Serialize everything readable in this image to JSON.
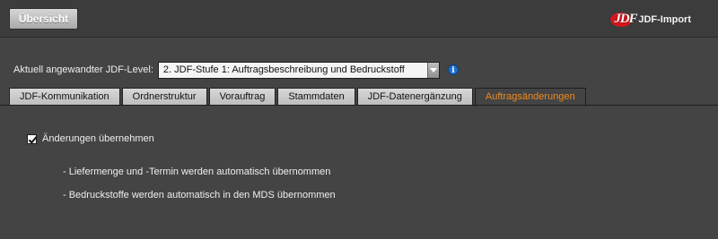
{
  "header": {
    "overview_button": "Übersicht",
    "brand_logo_text": "JDF",
    "brand_title": "JDF-Import"
  },
  "level": {
    "label": "Aktuell angewandter JDF-Level:",
    "selected": "2. JDF-Stufe 1: Auftragsbeschreibung und Bedruckstoff",
    "info_icon": "info-icon"
  },
  "tabs": [
    {
      "label": "JDF-Kommunikation",
      "active": false
    },
    {
      "label": "Ordnerstruktur",
      "active": false
    },
    {
      "label": "Vorauftrag",
      "active": false
    },
    {
      "label": "Stammdaten",
      "active": false
    },
    {
      "label": "JDF-Datenergänzung",
      "active": false
    },
    {
      "label": "Auftragsänderungen",
      "active": true
    }
  ],
  "content": {
    "checkbox_label": "Änderungen übernehmen",
    "checkbox_checked": true,
    "notes": [
      "-  Liefermenge und -Termin werden automatisch übernommen",
      "-  Bedruckstoffe werden automatisch in den MDS übernommen"
    ]
  },
  "colors": {
    "background": "#444444",
    "active_tab_text": "#f08a1c",
    "brand_red": "#d4151b",
    "info_blue": "#1d6fd0"
  }
}
